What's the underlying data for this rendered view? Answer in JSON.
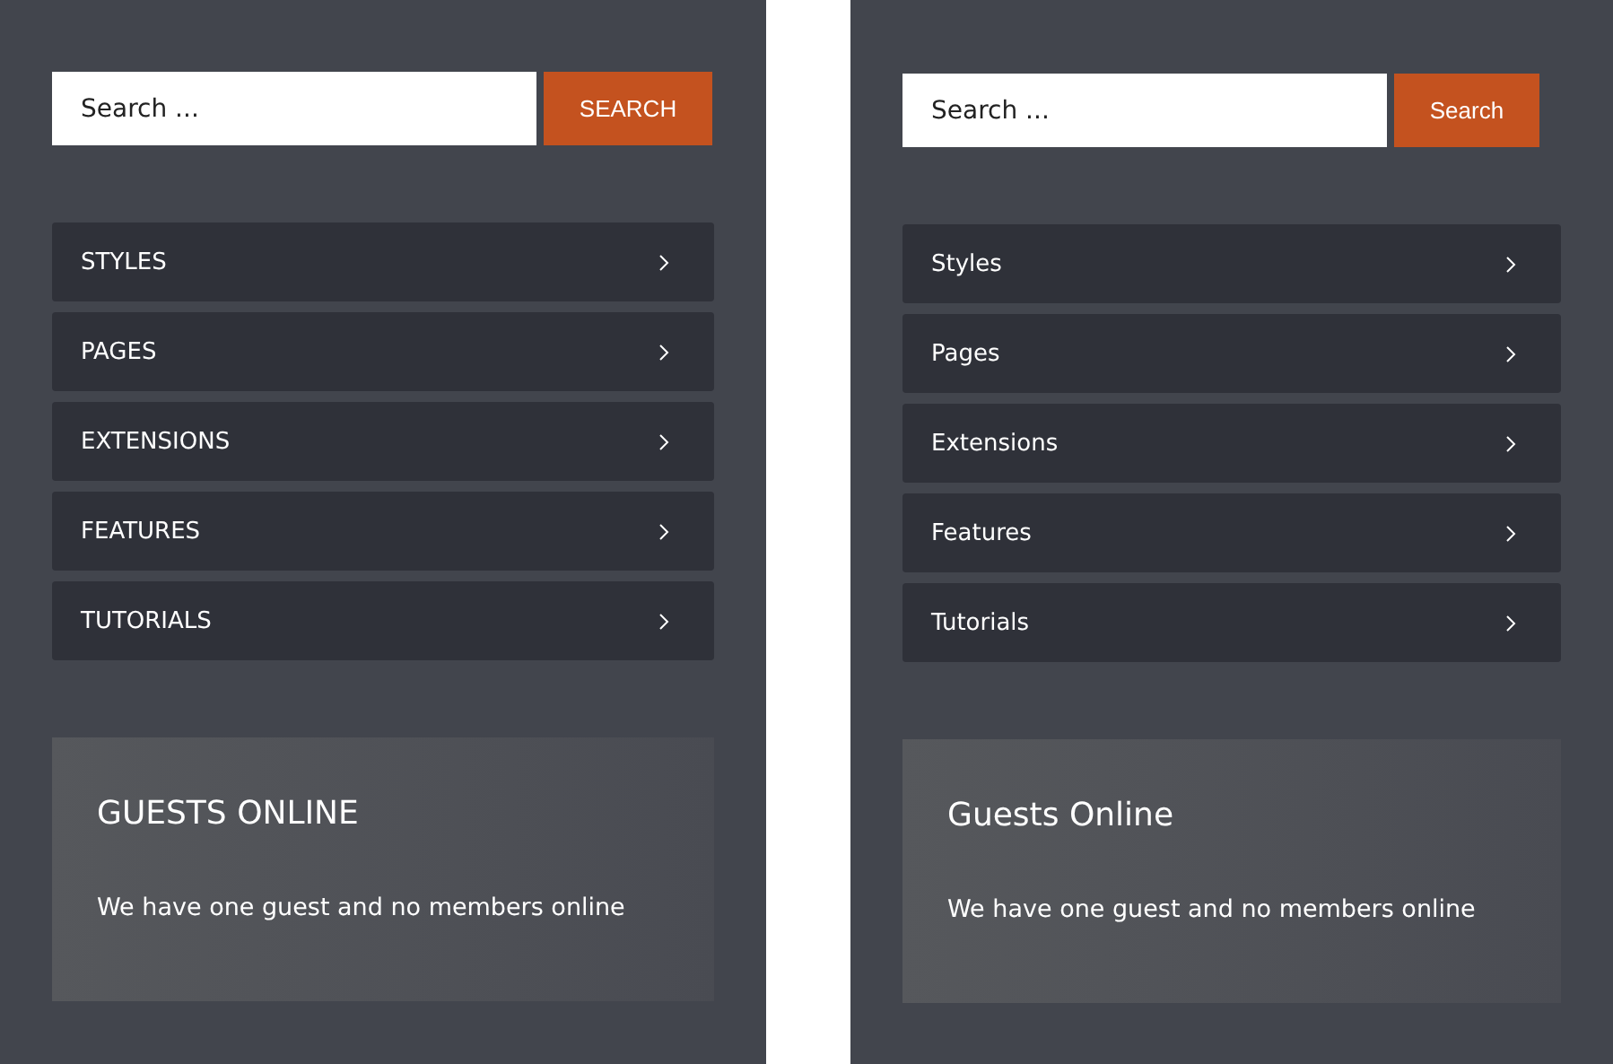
{
  "panels": [
    {
      "search": {
        "placeholder": "Search ..."
      },
      "search_button": "SEARCH",
      "menu": [
        "STYLES",
        "PAGES",
        "EXTENSIONS",
        "FEATURES",
        "TUTORIALS"
      ],
      "widget": {
        "title": "GUESTS ONLINE",
        "text": "We have one guest and no members online"
      }
    },
    {
      "search": {
        "placeholder": "Search ..."
      },
      "search_button": "Search",
      "menu": [
        "Styles",
        "Pages",
        "Extensions",
        "Features",
        "Tutorials"
      ],
      "widget": {
        "title": "Guests Online",
        "text": "We have one guest and no members online"
      }
    }
  ]
}
